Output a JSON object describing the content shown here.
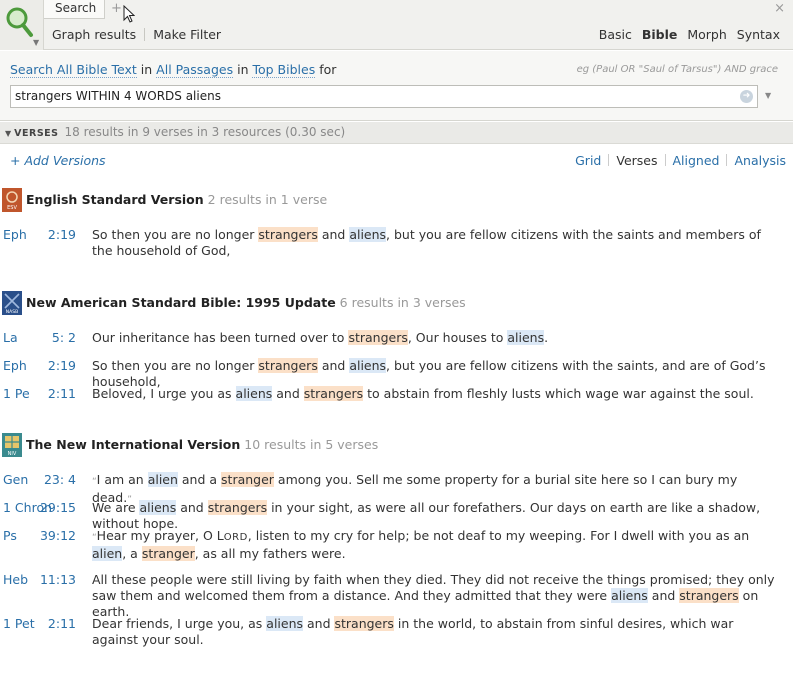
{
  "toolbar": {
    "tab_label": "Search",
    "add_tab": "+",
    "close_tab": "×",
    "graph_results": "Graph results",
    "make_filter": "Make Filter",
    "modes": [
      "Basic",
      "Bible",
      "Morph",
      "Syntax"
    ],
    "active_mode": "Bible"
  },
  "search": {
    "scope_prefix": "Search All Bible Text",
    "scope_in": "in",
    "scope_passages": "All Passages",
    "scope_in2": "in",
    "scope_bibles": "Top Bibles",
    "scope_for": "for",
    "example": "eg (Paul OR \"Saul of Tarsus\") AND grace",
    "query": "strangers WITHIN 4 WORDS aliens"
  },
  "results": {
    "section_label": "VERSES",
    "summary": "18 results in 9 verses in 3 resources (0.30 sec)",
    "add_versions": "+ Add Versions",
    "views": [
      "Grid",
      "Verses",
      "Aligned",
      "Analysis"
    ],
    "active_view": "Verses"
  },
  "resources": [
    {
      "icon": "esv-icon",
      "icon_color": "#c0562c",
      "icon_label": "ESV",
      "title": "English Standard Version",
      "count": "2 results in 1 verse",
      "verses": [
        {
          "book": "Eph",
          "ref": "2:19",
          "text": "So then you are no longer [o]strangers[/] and [b]aliens[/], but you are fellow citizens with the saints and members of the household of God,"
        }
      ]
    },
    {
      "icon": "nasb-icon",
      "icon_color": "#2a4f8a",
      "icon_label": "NASB",
      "title": "New American Standard Bible: 1995 Update",
      "count": "6 results in 3 verses",
      "verses": [
        {
          "book": "La",
          "ref": "5:  2",
          "text": "Our inheritance has been turned over to [o]strangers[/], Our houses to [b]aliens[/]."
        },
        {
          "book": "Eph",
          "ref": "2:19",
          "text": "So then you are no longer [o]strangers[/] and [b]aliens[/], but you are fellow citizens with the saints, and are of God’s household,"
        },
        {
          "book": "1 Pe",
          "ref": "2:11",
          "text": "Beloved, I urge you as [b]aliens[/] and [o]strangers[/] to abstain from fleshly lusts which wage war against the soul."
        }
      ]
    },
    {
      "icon": "niv-icon",
      "icon_color": "#3a8a8e",
      "icon_label": "NIV",
      "title": "The New International Version",
      "count": "10 results in 5 verses",
      "verses": [
        {
          "book": "Gen",
          "ref": "23:  4",
          "text": "[q]“[/]I am an [b]alien[/] and a [o]stranger[/] among you. Sell me some property for a burial site here so I can bury my dead.[q]”[/]"
        },
        {
          "book": "1 Chron",
          "ref": "29:15",
          "text": "We are [b]aliens[/] and [o]strangers[/] in your sight, as were all our forefathers. Our days on earth are like a shadow, without hope."
        },
        {
          "book": "Ps",
          "ref": "39:12",
          "text": "[q]“[/]Hear my prayer, O L[s]ORD[/], listen to my cry for help; be not deaf to my weeping. For I dwell with you as an [b]alien[/], a [o]stranger[/], as all my fathers were."
        },
        {
          "book": "Heb",
          "ref": "11:13",
          "text": "All these people were still living by faith when they died. They did not receive the things promised; they only saw them and welcomed them from a distance. And they admitted that they were [b]aliens[/] and [o]strangers[/] on earth."
        },
        {
          "book": "1 Pet",
          "ref": "2:11",
          "text": "Dear friends, I urge you, as [b]aliens[/] and [o]strangers[/] in the world, to abstain from sinful desires, which war against your soul."
        }
      ]
    }
  ]
}
